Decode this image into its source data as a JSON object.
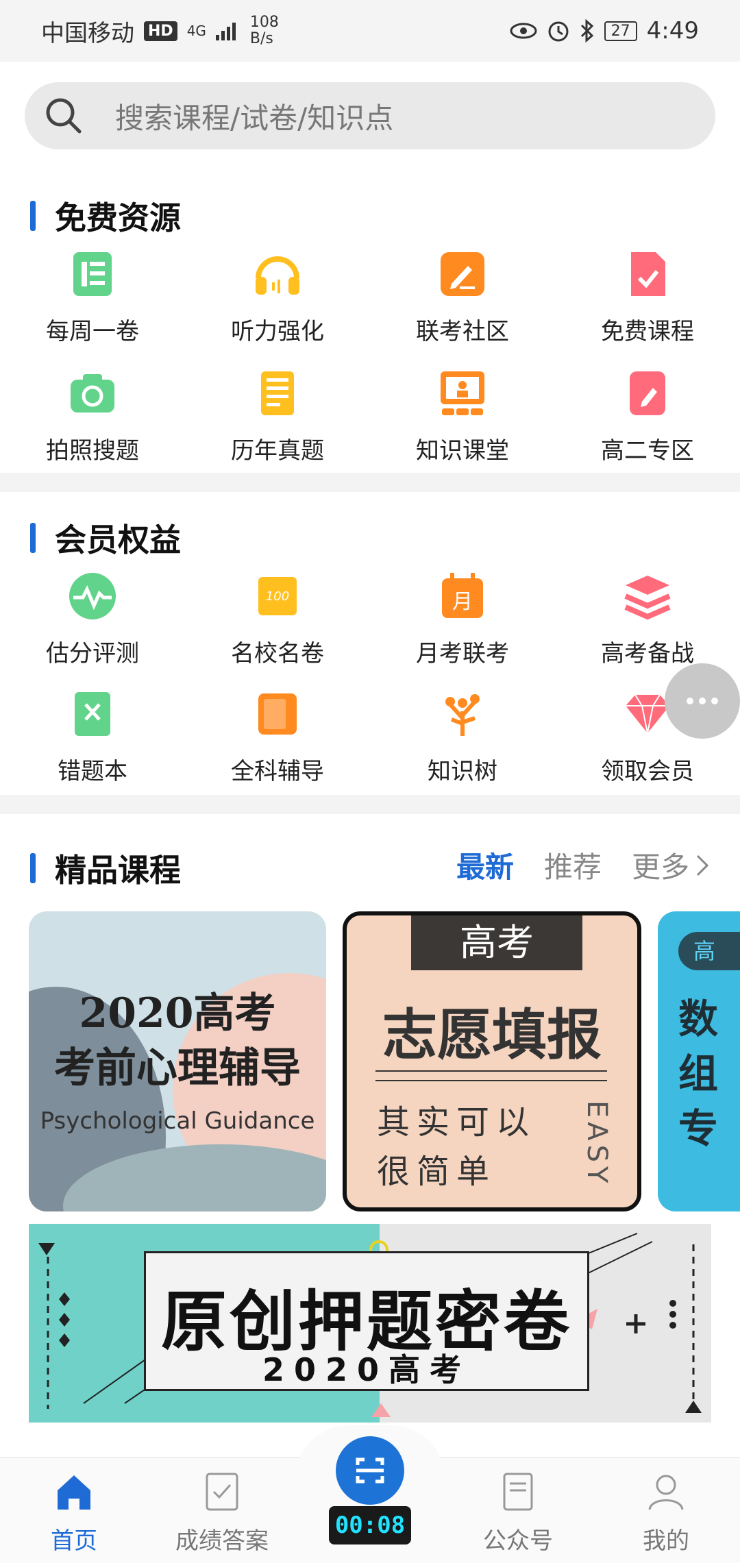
{
  "status_bar": {
    "carrier": "中国移动",
    "hd": "HD",
    "network": "4G",
    "speed_value": "108",
    "speed_unit": "B/s",
    "battery": "27",
    "time": "4:49"
  },
  "search": {
    "placeholder": "搜索课程/试卷/知识点"
  },
  "free_resources": {
    "title": "免费资源",
    "items": [
      {
        "label": "每周一卷",
        "icon": "document-icon",
        "color": "#61d38a"
      },
      {
        "label": "听力强化",
        "icon": "headphones-icon",
        "color": "#ffbf1f"
      },
      {
        "label": "联考社区",
        "icon": "edit-icon",
        "color": "#ff8a1f"
      },
      {
        "label": "免费课程",
        "icon": "checked-file-icon",
        "color": "#ff6b7a"
      },
      {
        "label": "拍照搜题",
        "icon": "camera-icon",
        "color": "#61d38a"
      },
      {
        "label": "历年真题",
        "icon": "scroll-icon",
        "color": "#ffbf1f"
      },
      {
        "label": "知识课堂",
        "icon": "classroom-icon",
        "color": "#ff8a1f"
      },
      {
        "label": "高二专区",
        "icon": "bookmark-edit-icon",
        "color": "#ff6b7a"
      }
    ]
  },
  "member_rights": {
    "title": "会员权益",
    "items": [
      {
        "label": "估分评测",
        "icon": "pulse-icon",
        "color": "#61d38a"
      },
      {
        "label": "名校名卷",
        "icon": "exam-paper-icon",
        "color": "#ffbf1f"
      },
      {
        "label": "月考联考",
        "icon": "calendar-icon",
        "color": "#ff8a1f"
      },
      {
        "label": "高考备战",
        "icon": "stack-icon",
        "color": "#ff6b7a"
      },
      {
        "label": "错题本",
        "icon": "wrong-book-icon",
        "color": "#61d38a"
      },
      {
        "label": "全科辅导",
        "icon": "book-icon",
        "color": "#ff8a1f"
      },
      {
        "label": "知识树",
        "icon": "tree-icon",
        "color": "#ff8a1f"
      },
      {
        "label": "领取会员",
        "icon": "diamond-icon",
        "color": "#ff6b7a"
      }
    ]
  },
  "premium_courses": {
    "title": "精品课程",
    "tabs": {
      "latest": "最新",
      "recommended": "推荐",
      "more": "更多"
    },
    "cards": [
      {
        "line1": "2020高考",
        "line2": "考前心理辅导",
        "subtitle": "Psychological Guidance"
      },
      {
        "top": "高考",
        "main": "志愿填报",
        "sub1": "其实可以",
        "sub2": "很简单",
        "side": "EASY"
      },
      {
        "badge": "高",
        "t1": "数",
        "t2": "组",
        "t3": "专"
      }
    ]
  },
  "banner": {
    "title": "原创押题密卷",
    "year": "2020高考"
  },
  "bottom_nav": {
    "items": [
      {
        "label": "首页",
        "icon": "home-icon",
        "active": true
      },
      {
        "label": "成绩答案",
        "icon": "report-icon",
        "active": false
      },
      {
        "label": "公众号",
        "icon": "article-icon",
        "active": false
      },
      {
        "label": "我的",
        "icon": "profile-icon",
        "active": false
      }
    ],
    "timer": "00:08"
  },
  "colors": {
    "accent": "#1e6bd6",
    "green": "#61d38a",
    "yellow": "#ffbf1f",
    "orange": "#ff8a1f",
    "pink": "#ff6b7a"
  }
}
